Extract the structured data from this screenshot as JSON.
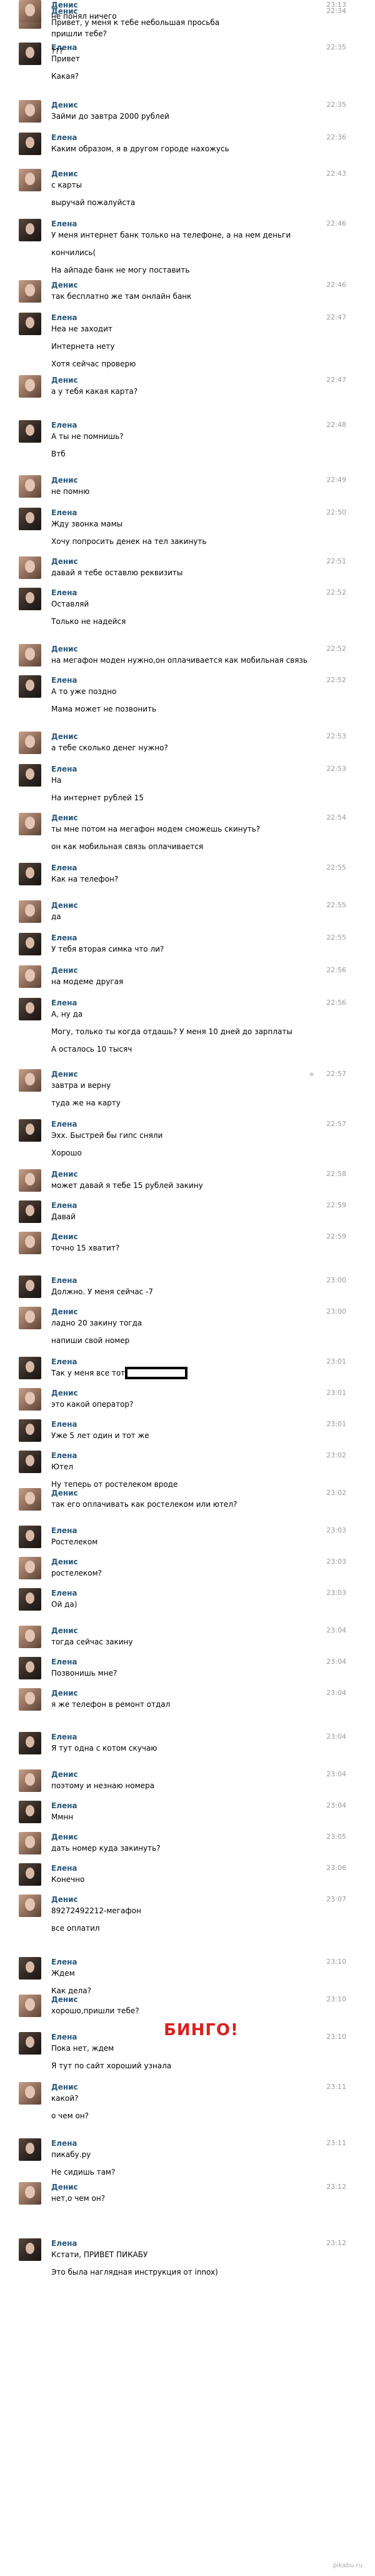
{
  "messages": [
    {
      "author": "Денис",
      "time": "22:34",
      "lines": [
        "Привет, у меня к тебе небольшая просьба"
      ]
    },
    {
      "author": "Елена",
      "time": "22:35",
      "lines": [
        "Привет",
        "Какая?"
      ]
    },
    {
      "author": "Денис",
      "time": "22:35",
      "lines": [
        "Займи до завтра 2000 рублей"
      ]
    },
    {
      "author": "Елена",
      "time": "22:36",
      "lines": [
        "Каким образом, я в другом городе нахожусь"
      ]
    },
    {
      "author": "Денис",
      "time": "22:43",
      "lines": [
        "с карты",
        "выручай пожалуйста"
      ]
    },
    {
      "author": "Елена",
      "time": "22:46",
      "lines": [
        "У меня интернет банк только на телефоне, а на нем деньги",
        "кончились(",
        "На айпаде банк не могу поставить"
      ]
    },
    {
      "author": "Денис",
      "time": "22:46",
      "lines": [
        "так бесплатно же там онлайн банк"
      ]
    },
    {
      "author": "Елена",
      "time": "22:47",
      "lines": [
        "Неа не заходит",
        "Интернета нету",
        "Хотя сейчас проверю"
      ]
    },
    {
      "author": "Денис",
      "time": "22:47",
      "lines": [
        "а у тебя какая карта?"
      ]
    },
    {
      "author": "Елена",
      "time": "22:48",
      "lines": [
        "А ты не помнишь?",
        "Втб"
      ]
    },
    {
      "author": "Денис",
      "time": "22:49",
      "lines": [
        "не помню"
      ]
    },
    {
      "author": "Елена",
      "time": "22:50",
      "lines": [
        "Жду звонка мамы",
        "Хочу попросить денек на тел закинуть"
      ]
    },
    {
      "author": "Денис",
      "time": "22:51",
      "lines": [
        "давай я тебе оставлю реквизиты"
      ]
    },
    {
      "author": "Елена",
      "time": "22:52",
      "lines": [
        "Оставляй",
        "Только не надейся"
      ]
    },
    {
      "author": "Денис",
      "time": "22:52",
      "lines": [
        "на мегафон моден нужно,он оплачивается как мобильная связь"
      ]
    },
    {
      "author": "Елена",
      "time": "22:52",
      "lines": [
        "А то уже поздно",
        "Мама может не позвонить"
      ]
    },
    {
      "author": "Денис",
      "time": "22:53",
      "lines": [
        "а тебе сколько денег нужно?"
      ]
    },
    {
      "author": "Елена",
      "time": "22:53",
      "lines": [
        "На",
        "На интернет рублей 15"
      ]
    },
    {
      "author": "Денис",
      "time": "22:54",
      "lines": [
        "ты мне потом на мегафон модем сможешь скинуть?",
        "он как мобильная связь оплачивается"
      ]
    },
    {
      "author": "Елена",
      "time": "22:55",
      "lines": [
        "Как на телефон?"
      ]
    },
    {
      "author": "Денис",
      "time": "22:55",
      "lines": [
        "да"
      ]
    },
    {
      "author": "Елена",
      "time": "22:55",
      "lines": [
        "У тебя вторая симка что ли?"
      ]
    },
    {
      "author": "Денис",
      "time": "22:56",
      "lines": [
        "на модеме другая"
      ]
    },
    {
      "author": "Елена",
      "time": "22:56",
      "lines": [
        "А, ну да",
        "Могу, только ты когда отдашь? У меня 10 дней до зарплаты",
        "А осталось 10 тысяч"
      ]
    },
    {
      "author": "Денис",
      "time": "22:57",
      "lines": [
        "завтра и верну",
        "туда же на карту"
      ]
    },
    {
      "author": "Елена",
      "time": "22:57",
      "lines": [
        "Эхх. Быстрей бы гипс сняли",
        "Хорошо"
      ]
    },
    {
      "author": "Денис",
      "time": "22:58",
      "lines": [
        "может давай я тебе 15 рублей закину"
      ]
    },
    {
      "author": "Елена",
      "time": "22:59",
      "lines": [
        "Давай"
      ]
    },
    {
      "author": "Денис",
      "time": "22:59",
      "lines": [
        "точно 15 хватит?"
      ]
    },
    {
      "author": "Елена",
      "time": "23:00",
      "lines": [
        "Должно. У меня сейчас -7"
      ]
    },
    {
      "author": "Денис",
      "time": "23:00",
      "lines": [
        "ладно 20 закину тогда",
        "напиши свой номер"
      ]
    },
    {
      "author": "Елена",
      "time": "23:01",
      "lines": [
        "Так у меня все тот же"
      ]
    },
    {
      "author": "Денис",
      "time": "23:01",
      "lines": [
        "это какой оператор?"
      ]
    },
    {
      "author": "Елена",
      "time": "23:01",
      "lines": [
        "Уже 5 лет один и тот же"
      ]
    },
    {
      "author": "Елена",
      "time": "23:02",
      "lines": [
        "Ютел",
        "Ну теперь от ростелеком вроде"
      ]
    },
    {
      "author": "Денис",
      "time": "23:02",
      "lines": [
        "так его оплачивать как ростелеком или ютел?"
      ]
    },
    {
      "author": "Елена",
      "time": "23:03",
      "lines": [
        "Ростелеком"
      ]
    },
    {
      "author": "Денис",
      "time": "23:03",
      "lines": [
        "ростелеком?"
      ]
    },
    {
      "author": "Елена",
      "time": "23:03",
      "lines": [
        "Ой да)"
      ]
    },
    {
      "author": "Денис",
      "time": "23:04",
      "lines": [
        "тогда сейчас закину"
      ]
    },
    {
      "author": "Елена",
      "time": "23:04",
      "lines": [
        "Позвонишь мне?"
      ]
    },
    {
      "author": "Денис",
      "time": "23:04",
      "lines": [
        "я же телефон в ремонт отдал"
      ]
    },
    {
      "author": "Елена",
      "time": "23:04",
      "lines": [
        "Я тут одна с котом скучаю"
      ]
    },
    {
      "author": "Денис",
      "time": "23:04",
      "lines": [
        "поэтому и незнаю номера"
      ]
    },
    {
      "author": "Елена",
      "time": "23:04",
      "lines": [
        "Ммнн"
      ]
    },
    {
      "author": "Денис",
      "time": "23:05",
      "lines": [
        "дать номер куда закинуть?"
      ]
    },
    {
      "author": "Елена",
      "time": "23:06",
      "lines": [
        "Конечно"
      ]
    },
    {
      "author": "Денис",
      "time": "23:07",
      "lines": [
        "89272492212-мегафон",
        "все оплатил"
      ]
    },
    {
      "author": "Елена",
      "time": "23:10",
      "lines": [
        "Ждем",
        "Как дела?"
      ]
    },
    {
      "author": "Денис",
      "time": "23:10",
      "lines": [
        "хорошо,пришли тебе?"
      ]
    },
    {
      "author": "Елена",
      "time": "23:10",
      "lines": [
        "Пока нет, ждем",
        "Я тут по сайт хороший узнала"
      ]
    },
    {
      "author": "Денис",
      "time": "23:11",
      "lines": [
        "какой?",
        "о чем он?"
      ]
    },
    {
      "author": "Елена",
      "time": "23:11",
      "lines": [
        "пикабу.ру",
        "Не сидишь там?"
      ]
    },
    {
      "author": "Денис",
      "time": "23:12",
      "lines": [
        "нет,о чем он?"
      ]
    },
    {
      "author": "Елена",
      "time": "23:12",
      "lines": [
        "Кстати, ПРИВЕТ ПИКАБУ",
        "Это была наглядная инструкция от innox)"
      ]
    },
    {
      "author": "Денис",
      "time": "23:13",
      "lines": [
        "не понял ничего",
        "пришли тебе?",
        "???"
      ]
    }
  ],
  "overlay": {
    "bingo": "БИНГО!",
    "watermark": "pikabu.ru"
  },
  "colors": {
    "author": "#2b587a",
    "time": "#999999",
    "bingo": "#d92020"
  }
}
